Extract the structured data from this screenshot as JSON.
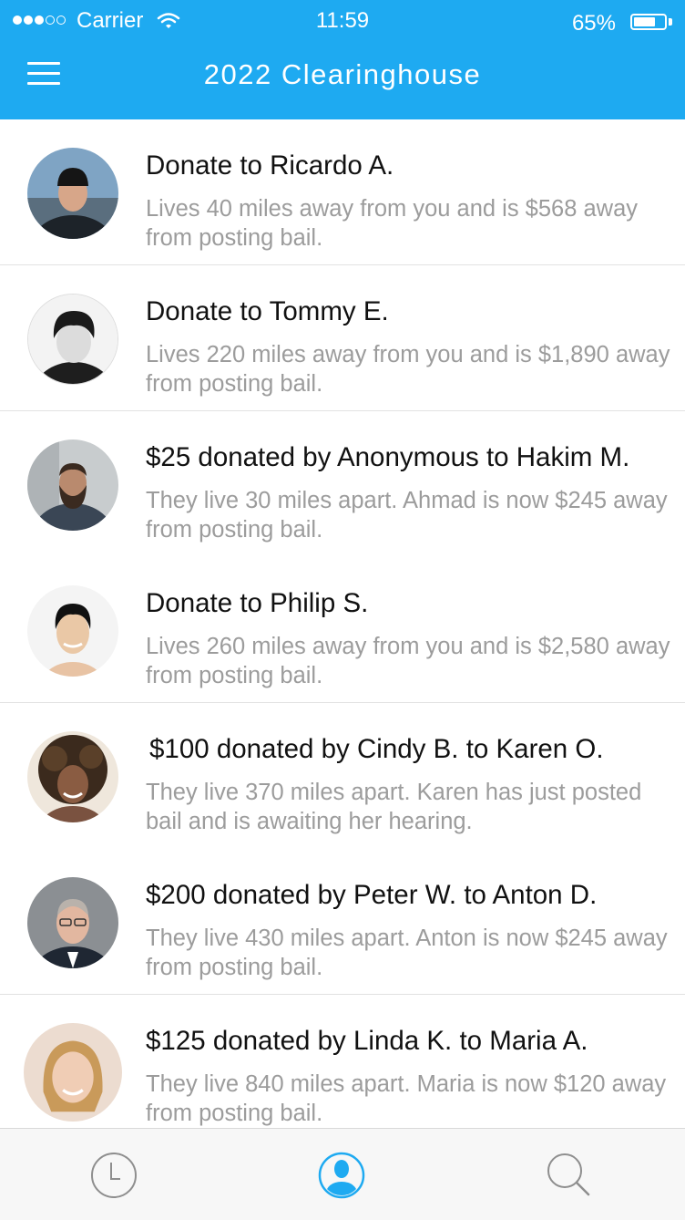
{
  "status_bar": {
    "carrier": "Carrier",
    "time": "11:59",
    "battery": "65%",
    "battery_level": 0.65
  },
  "nav": {
    "title": "2022 Clearinghouse",
    "menu_icon": "hamburger-menu-icon"
  },
  "feed": [
    {
      "title": "Donate to Ricardo A.",
      "subtitle": "Lives 40 miles away from you and is $568 away from posting bail."
    },
    {
      "title": "Donate to Tommy E.",
      "subtitle": "Lives 220 miles away from you and is $1,890 away from posting bail."
    },
    {
      "title": "$25 donated by Anonymous to Hakim M.",
      "subtitle": "They live 30 miles apart. Ahmad is now $245 away from posting bail."
    },
    {
      "title": "Donate to Philip S.",
      "subtitle": "Lives 260 miles away from you and is $2,580 away from posting bail."
    },
    {
      "title": "$100 donated by Cindy B. to Karen O.",
      "subtitle": "They live 370 miles apart. Karen has just posted bail and is awaiting her hearing."
    },
    {
      "title": "$200 donated by Peter W. to Anton D.",
      "subtitle": "They live 430 miles apart. Anton is now $245 away from posting bail."
    },
    {
      "title": "$125 donated by Linda K. to Maria A.",
      "subtitle": "They live 840 miles apart. Maria is now $120 away from posting bail."
    }
  ],
  "tab_bar": {
    "tabs": [
      {
        "icon": "clock-icon",
        "active": false
      },
      {
        "icon": "profile-icon",
        "active": true
      },
      {
        "icon": "search-icon",
        "active": false
      }
    ],
    "active_color": "#1eaaf1",
    "inactive_color": "#8e8e8e"
  },
  "colors": {
    "header": "#1eaaf1",
    "title_text": "#111111",
    "subtitle_text": "#9c9c9c"
  }
}
